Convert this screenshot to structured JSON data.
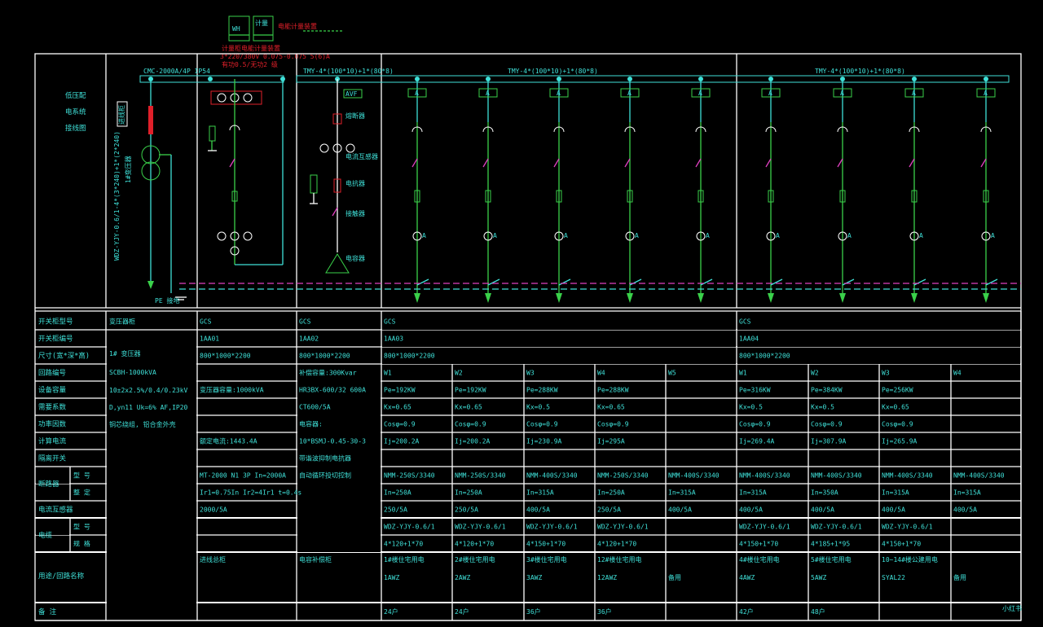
{
  "colors": {
    "background": "#000000",
    "grid": "#ffffff",
    "cyan": "#3fe0d8",
    "green": "#3ad14a",
    "magenta": "#e040c0",
    "red": "#e0202a"
  },
  "top": {
    "meter_box": "WH",
    "meter_box2": "计量",
    "meter_note": "电能计量装置",
    "meter_spec_1": "计量柜电能计量装置",
    "meter_spec_2": "3*220/380V 0.075-0.075 5(6)A",
    "meter_spec_3": "有功0.5/无功2 级",
    "left_title_1": "低压配",
    "left_title_2": "电系统",
    "left_title_3": "接线图",
    "bus_main": "CMC-2000A/4P IP54",
    "bus_1": "TMY-4*(100*10)+1*(80*8)",
    "bus_2": "TMY-4*(100*10)+1*(80*8)",
    "bus_3": "TMY-4*(100*10)+1*(80*8)",
    "avr_box": "AVF",
    "ammeter_box": "A",
    "transformer_tag": "1#变压器",
    "cabinet_tag": "进线柜",
    "vertical_note": "WDZ-YJY-0.6/1-4*(3*240)+1*(2*240)",
    "pe_label": "PE 接地",
    "cap_labels": [
      "熔断器",
      "电流互感器",
      "电抗器",
      "接触器",
      "电容器"
    ]
  },
  "table": {
    "row_labels": [
      "开关柜型号",
      "开关柜编号",
      "尺寸(宽*深*高)",
      "回路编号",
      "设备容量",
      "需要系数",
      "功率因数",
      "计算电流",
      "隔离开关",
      "断路器",
      "",
      "电流互感器",
      "电缆",
      "",
      "用途/回路名称",
      "备  注"
    ],
    "sub_labels": {
      "breaker_model": "型 号",
      "breaker_setting": "整 定",
      "cable_model": "型 号",
      "cable_spec": "规 格"
    },
    "transformer_col": {
      "header": "变压器柜",
      "lines": [
        "1# 变压器",
        "SCBH-1000kVA",
        "10±2x2.5%/0.4/0.23kV",
        "D,yn11 Uk=6% AF,IP20",
        "铜芯绕组, 铝合金外壳"
      ]
    },
    "incoming": {
      "type": "GCS",
      "id": "1AA01",
      "size": "800*1000*2200",
      "capacity": "变压器容量:1000kVA",
      "current": "额定电流:1443.4A",
      "breaker_model": "MT-2000 N1 3P In=2000A",
      "breaker_setting": "Ir1=0.75In Ir2=4Ir1 t=0.4s",
      "ct": "2000/5A",
      "purpose": "进线总柜"
    },
    "capacitor": {
      "type": "GCS",
      "id": "1AA02",
      "size": "800*1000*2200",
      "lines": [
        "补偿容量:300Kvar",
        "HR3BX-600/32 600A",
        "CT600/5A",
        "电容器:",
        "10*BSMJ-0.45-30-3",
        "带谐波抑制电抗器",
        "自动循环投切控制"
      ],
      "purpose": "电容补偿柜"
    },
    "groups": [
      {
        "type": "GCS",
        "id": "1AA03",
        "size": "800*1000*2200",
        "feeders": [
          {
            "no": "W1",
            "pe": "Pe=192KW",
            "kx": "Kx=0.65",
            "cos": "Cosφ=0.9",
            "ij": "Ij=200.2A",
            "breaker": "NMM-250S/3340",
            "in": "In=250A",
            "ct": "250/5A",
            "cable": "WDZ-YJY-0.6/1",
            "spec": "4*120+1*70",
            "use": "1#楼住宅用电",
            "box": "1AWZ",
            "note": "24户"
          },
          {
            "no": "W2",
            "pe": "Pe=192KW",
            "kx": "Kx=0.65",
            "cos": "Cosφ=0.9",
            "ij": "Ij=200.2A",
            "breaker": "NMM-250S/3340",
            "in": "In=250A",
            "ct": "250/5A",
            "cable": "WDZ-YJY-0.6/1",
            "spec": "4*120+1*70",
            "use": "2#楼住宅用电",
            "box": "2AWZ",
            "note": "24户"
          },
          {
            "no": "W3",
            "pe": "Pe=288KW",
            "kx": "Kx=0.5",
            "cos": "Cosφ=0.9",
            "ij": "Ij=230.9A",
            "breaker": "NMM-400S/3340",
            "in": "In=315A",
            "ct": "400/5A",
            "cable": "WDZ-YJY-0.6/1",
            "spec": "4*150+1*70",
            "use": "3#楼住宅用电",
            "box": "3AWZ",
            "note": "36户"
          },
          {
            "no": "W4",
            "pe": "Pe=288KW",
            "kx": "Kx=0.65",
            "cos": "Cosφ=0.9",
            "ij": "Ij=295A",
            "breaker": "NMM-250S/3340",
            "in": "In=250A",
            "ct": "250/5A",
            "cable": "WDZ-YJY-0.6/1",
            "spec": "4*120+1*70",
            "use": "12#楼住宅用电",
            "box": "12AWZ",
            "note": "36户"
          },
          {
            "no": "W5",
            "pe": "",
            "kx": "",
            "cos": "",
            "ij": "",
            "breaker": "NMM-400S/3340",
            "in": "In=315A",
            "ct": "400/5A",
            "cable": "",
            "spec": "",
            "use": "",
            "box": "备用",
            "note": ""
          }
        ]
      },
      {
        "type": "GCS",
        "id": "1AA04",
        "size": "800*1000*2200",
        "feeders": [
          {
            "no": "W1",
            "pe": "Pe=316KW",
            "kx": "Kx=0.5",
            "cos": "Cosφ=0.9",
            "ij": "Ij=269.4A",
            "breaker": "NMM-400S/3340",
            "in": "In=315A",
            "ct": "400/5A",
            "cable": "WDZ-YJY-0.6/1",
            "spec": "4*150+1*70",
            "use": "4#楼住宅用电",
            "box": "4AWZ",
            "note": "42户"
          },
          {
            "no": "W2",
            "pe": "Pe=384KW",
            "kx": "Kx=0.5",
            "cos": "Cosφ=0.9",
            "ij": "Ij=307.9A",
            "breaker": "NMM-400S/3340",
            "in": "In=350A",
            "ct": "400/5A",
            "cable": "WDZ-YJY-0.6/1",
            "spec": "4*185+1*95",
            "use": "5#楼住宅用电",
            "box": "5AWZ",
            "note": "48户"
          },
          {
            "no": "W3",
            "pe": "Pe=256KW",
            "kx": "Kx=0.65",
            "cos": "Cosφ=0.9",
            "ij": "Ij=265.9A",
            "breaker": "NMM-400S/3340",
            "in": "In=315A",
            "ct": "400/5A",
            "cable": "WDZ-YJY-0.6/1",
            "spec": "4*150+1*70",
            "use": "10~14#楼公建用电",
            "box": "SYAL22",
            "note": ""
          },
          {
            "no": "W4",
            "pe": "",
            "kx": "",
            "cos": "",
            "ij": "",
            "breaker": "NMM-400S/3340",
            "in": "In=315A",
            "ct": "400/5A",
            "cable": "",
            "spec": "",
            "use": "",
            "box": "备用",
            "note": ""
          }
        ]
      }
    ]
  },
  "watermark": "小红书"
}
